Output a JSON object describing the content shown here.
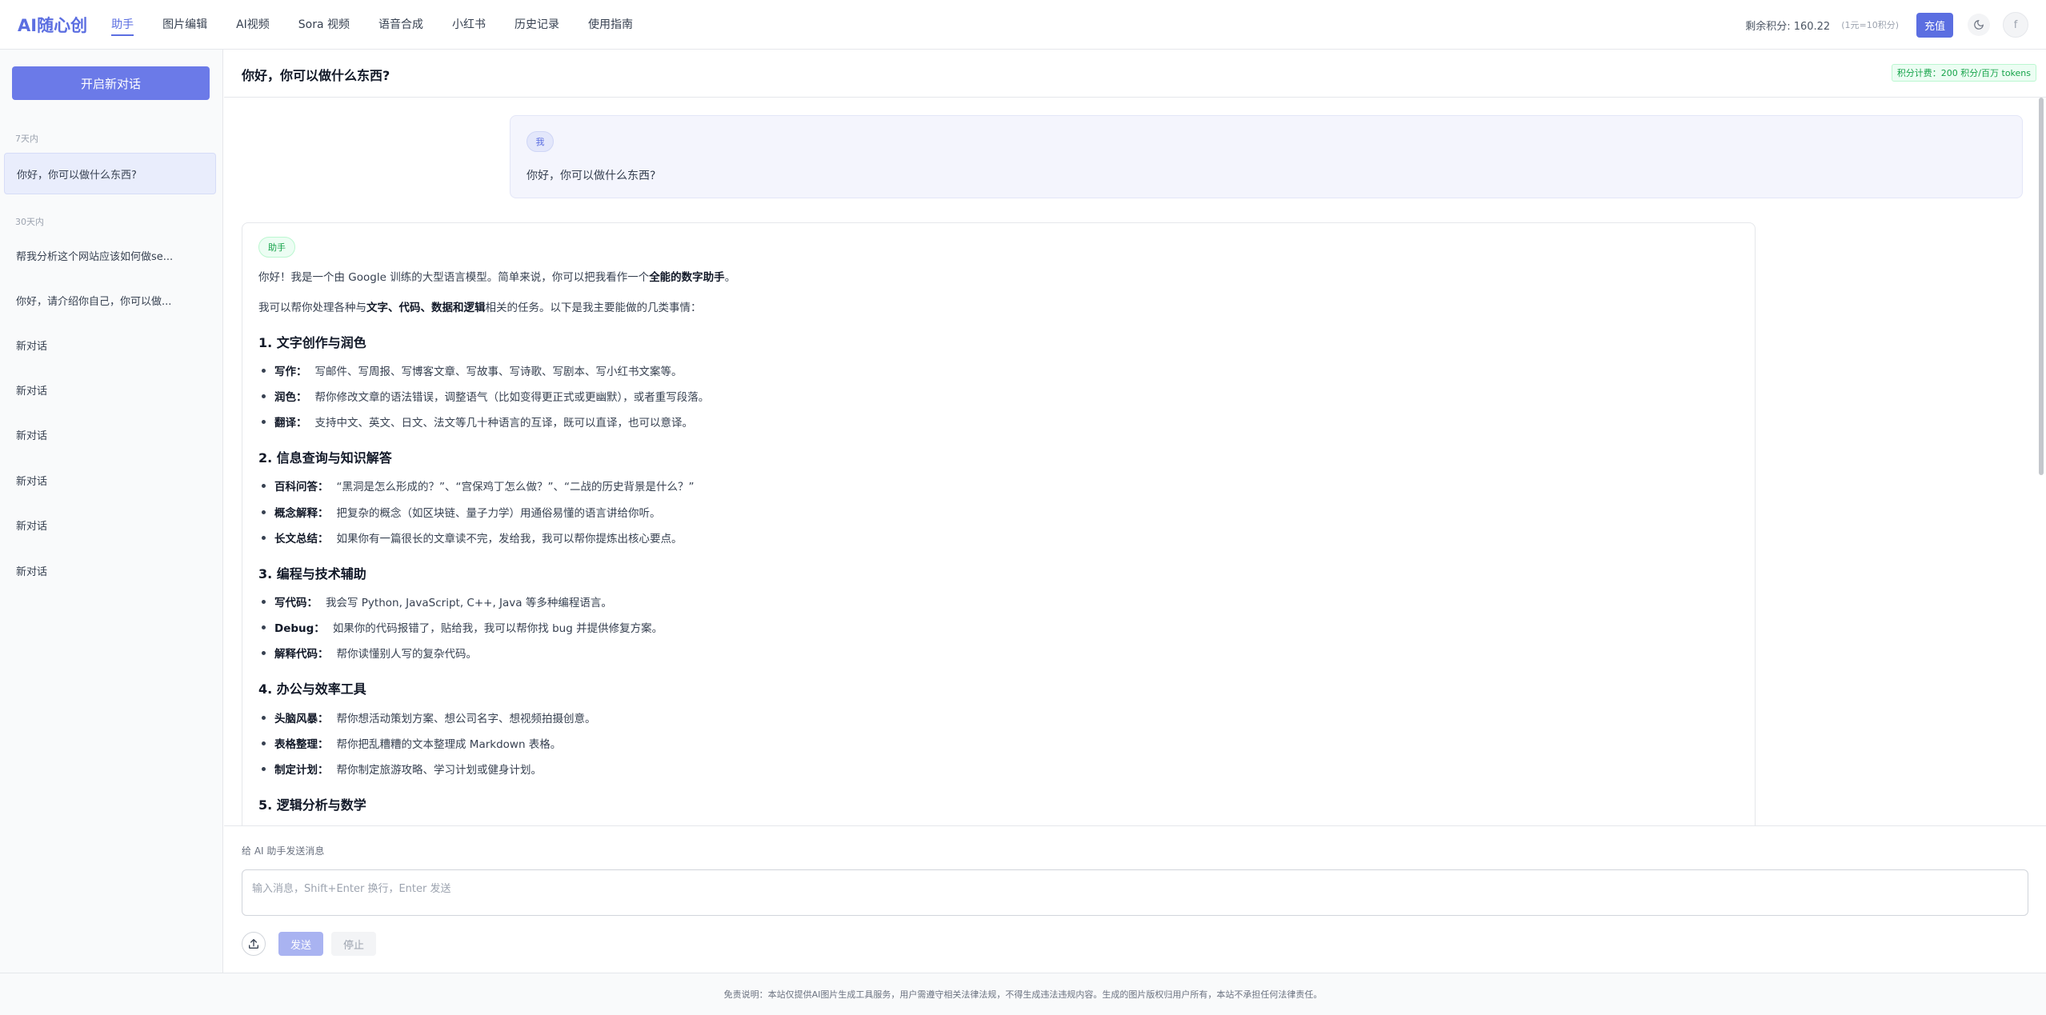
{
  "app": {
    "logo": "AI随心创"
  },
  "nav": {
    "items": [
      "助手",
      "图片编辑",
      "AI视频",
      "Sora 视频",
      "语音合成",
      "小红书",
      "历史记录",
      "使用指南"
    ],
    "active": "助手"
  },
  "account": {
    "credits": "剩余积分: 160.22",
    "rate": "(1元=10积分)",
    "recharge_label": "充值",
    "avatar_initial": "f"
  },
  "sidebar": {
    "new_chat_label": "开启新对话",
    "groups": [
      {
        "label": "7天内",
        "items": [
          "你好，你可以做什么东西?"
        ]
      },
      {
        "label": "30天内",
        "items": [
          "帮我分析这个网站应该如何做se...",
          "你好，请介绍你自己，你可以做...",
          "新对话",
          "新对话",
          "新对话",
          "新对话",
          "新对话",
          "新对话"
        ]
      }
    ],
    "active_item": "你好，你可以做什么东西?"
  },
  "chat": {
    "title": "你好，你可以做什么东西?",
    "billing": "积分计费：200 积分/百万 tokens",
    "user_badge": "我",
    "user_message": "你好，你可以做什么东西?",
    "bot_badge": "助手",
    "bot_intro_1_prefix": "你好！我是一个由 Google 训练的大型语言模型。简单来说，你可以把我看作一个",
    "bot_intro_1_bold": "全能的数字助手",
    "bot_intro_1_suffix": "。",
    "bot_intro_2_prefix": "我可以帮你处理各种与",
    "bot_intro_2_bold": "文字、代码、数据和逻辑",
    "bot_intro_2_suffix": "相关的任务。以下是我主要能做的几类事情：",
    "sections": [
      {
        "title": "1. 文字创作与润色",
        "bullets": [
          {
            "label": "写作：",
            "text": "写邮件、写周报、写博客文章、写故事、写诗歌、写剧本、写小红书文案等。"
          },
          {
            "label": "润色：",
            "text": "帮你修改文章的语法错误，调整语气（比如变得更正式或更幽默），或者重写段落。"
          },
          {
            "label": "翻译：",
            "text": "支持中文、英文、日文、法文等几十种语言的互译，既可以直译，也可以意译。"
          }
        ]
      },
      {
        "title": "2. 信息查询与知识解答",
        "bullets": [
          {
            "label": "百科问答：",
            "text": "“黑洞是怎么形成的？”、“宫保鸡丁怎么做？”、“二战的历史背景是什么？”"
          },
          {
            "label": "概念解释：",
            "text": "把复杂的概念（如区块链、量子力学）用通俗易懂的语言讲给你听。"
          },
          {
            "label": "长文总结：",
            "text": "如果你有一篇很长的文章读不完，发给我，我可以帮你提炼出核心要点。"
          }
        ]
      },
      {
        "title": "3. 编程与技术辅助",
        "bullets": [
          {
            "label": "写代码：",
            "text": "我会写 Python, JavaScript, C++, Java 等多种编程语言。"
          },
          {
            "label": "Debug：",
            "text": "如果你的代码报错了，贴给我，我可以帮你找 bug 并提供修复方案。"
          },
          {
            "label": "解释代码：",
            "text": "帮你读懂别人写的复杂代码。"
          }
        ]
      },
      {
        "title": "4. 办公与效率工具",
        "bullets": [
          {
            "label": "头脑风暴：",
            "text": "帮你想活动策划方案、想公司名字、想视频拍摄创意。"
          },
          {
            "label": "表格整理：",
            "text": "帮你把乱糟糟的文本整理成 Markdown 表格。"
          },
          {
            "label": "制定计划：",
            "text": "帮你制定旅游攻略、学习计划或健身计划。"
          }
        ]
      },
      {
        "title": "5. 逻辑分析与数学",
        "bullets": []
      }
    ]
  },
  "composer": {
    "label": "给 AI 助手发送消息",
    "placeholder": "输入消息，Shift+Enter 换行，Enter 发送",
    "send_label": "发送",
    "stop_label": "停止"
  },
  "footer": {
    "disclaimer": "免责说明：本站仅提供AI图片生成工具服务，用户需遵守相关法律法规，不得生成违法违规内容。生成的图片版权归用户所有，本站不承担任何法律责任。"
  }
}
